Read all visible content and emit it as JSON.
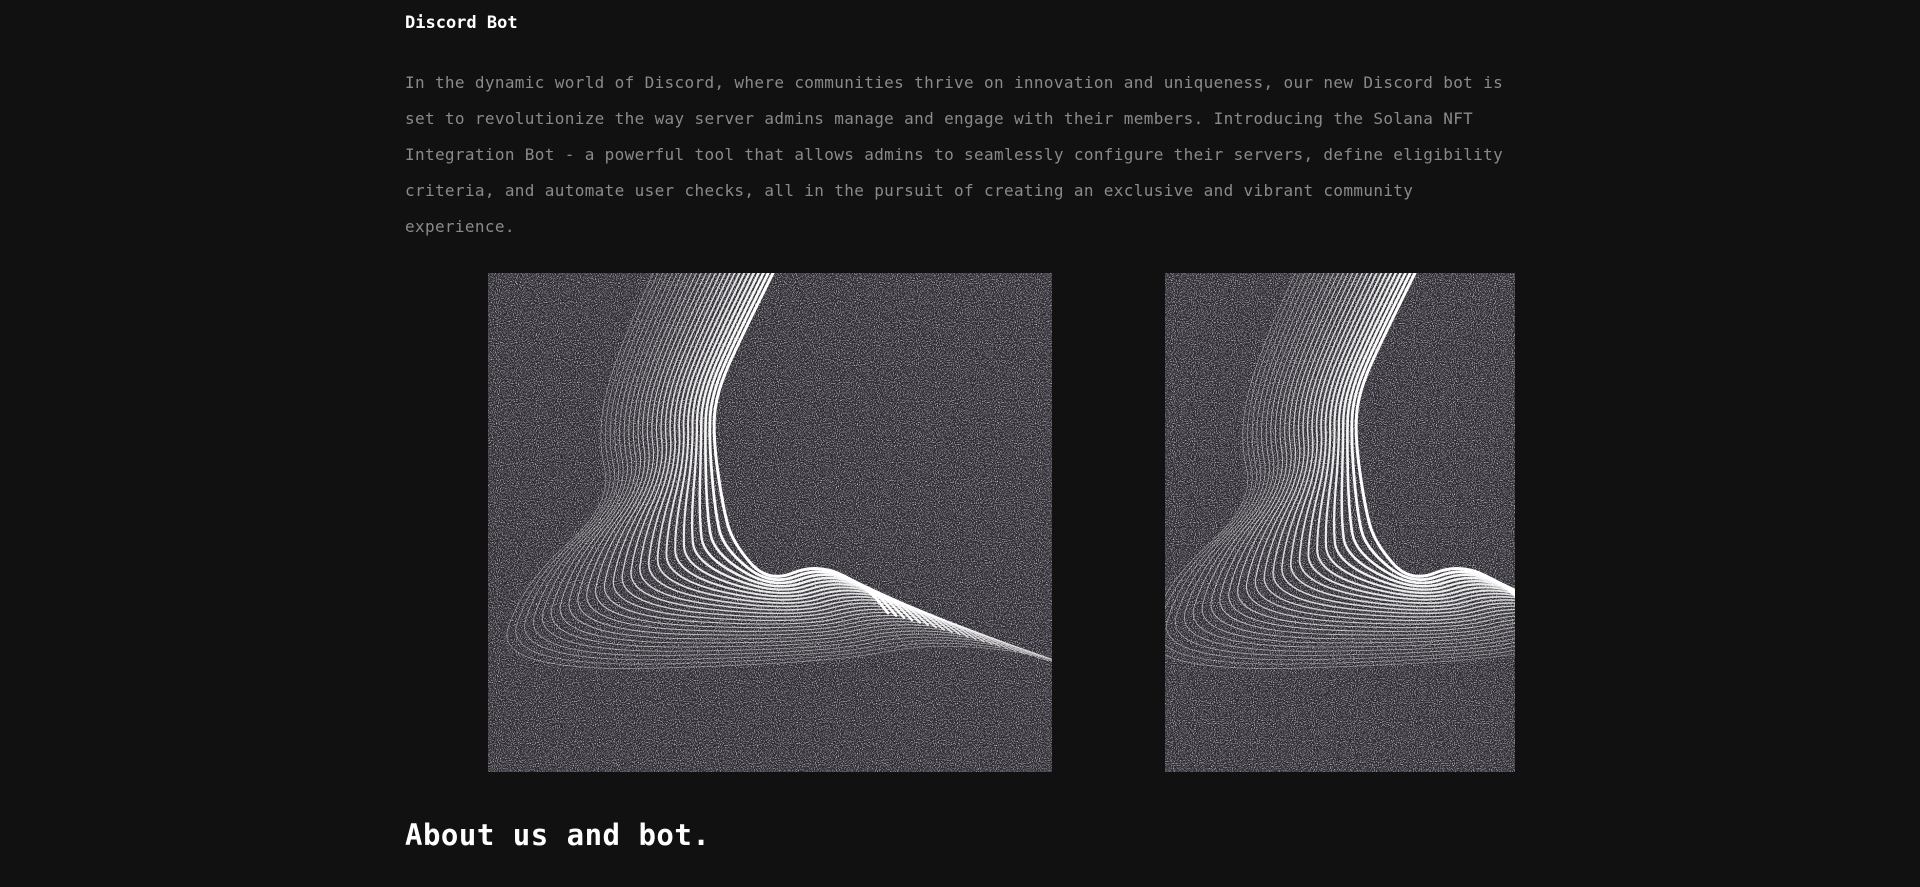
{
  "section": {
    "title": "Discord Bot",
    "intro": "In the dynamic world of Discord, where communities thrive on innovation and uniqueness, our new Discord bot is set to revolutionize the way server admins manage and engage with their members. Introducing the Solana NFT Integration Bot - a powerful tool that allows admins to seamlessly configure their servers, define eligibility criteria, and automate user checks, all in the pursuit of creating an exclusive and vibrant community experience."
  },
  "images": [
    {
      "name": "wave-line-art-left",
      "kind": "noise-contour-artwork"
    },
    {
      "name": "wave-line-art-right",
      "kind": "noise-contour-artwork"
    }
  ],
  "about": {
    "heading": "About us and bot."
  },
  "colors": {
    "background": "#111111",
    "heading": "#ffffff",
    "body_text": "#8a8a8a",
    "art_background": "#2c2a30",
    "art_lines": "#ffffff"
  }
}
